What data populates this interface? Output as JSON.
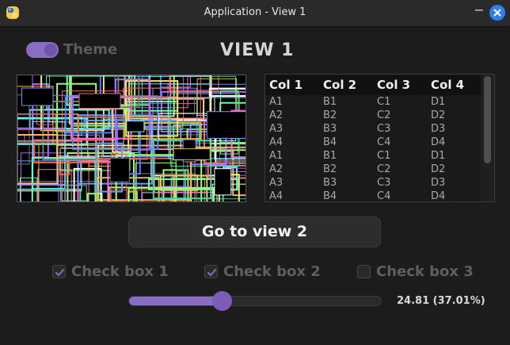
{
  "window": {
    "title": "Application - View 1",
    "icon": "python-icon",
    "minimize_symbol": "−",
    "close_icon": "close-icon"
  },
  "header": {
    "theme_label": "Theme",
    "theme_on": true,
    "view_title": "VIEW 1"
  },
  "table": {
    "columns": [
      "Col 1",
      "Col 2",
      "Col 3",
      "Col 4"
    ],
    "rows": [
      [
        "A1",
        "B1",
        "C1",
        "D1"
      ],
      [
        "A2",
        "B2",
        "C2",
        "D2"
      ],
      [
        "A3",
        "B3",
        "C3",
        "D3"
      ],
      [
        "A4",
        "B4",
        "C4",
        "D4"
      ],
      [
        "A1",
        "B1",
        "C1",
        "D1"
      ],
      [
        "A2",
        "B2",
        "C2",
        "D2"
      ],
      [
        "A3",
        "B3",
        "C3",
        "D3"
      ],
      [
        "A4",
        "B4",
        "C4",
        "D4"
      ]
    ]
  },
  "goto_button": {
    "label": "Go to view 2"
  },
  "checkboxes": [
    {
      "label": "Check box 1",
      "checked": true
    },
    {
      "label": "Check box 2",
      "checked": true
    },
    {
      "label": "Check box 3",
      "checked": false
    }
  ],
  "slider": {
    "fraction": 0.3701,
    "value_text": "24.81 (37.01%)"
  },
  "colors": {
    "accent": "#8b6cc4",
    "close_button": "#2f7df0",
    "background": "#1c1c1c"
  }
}
